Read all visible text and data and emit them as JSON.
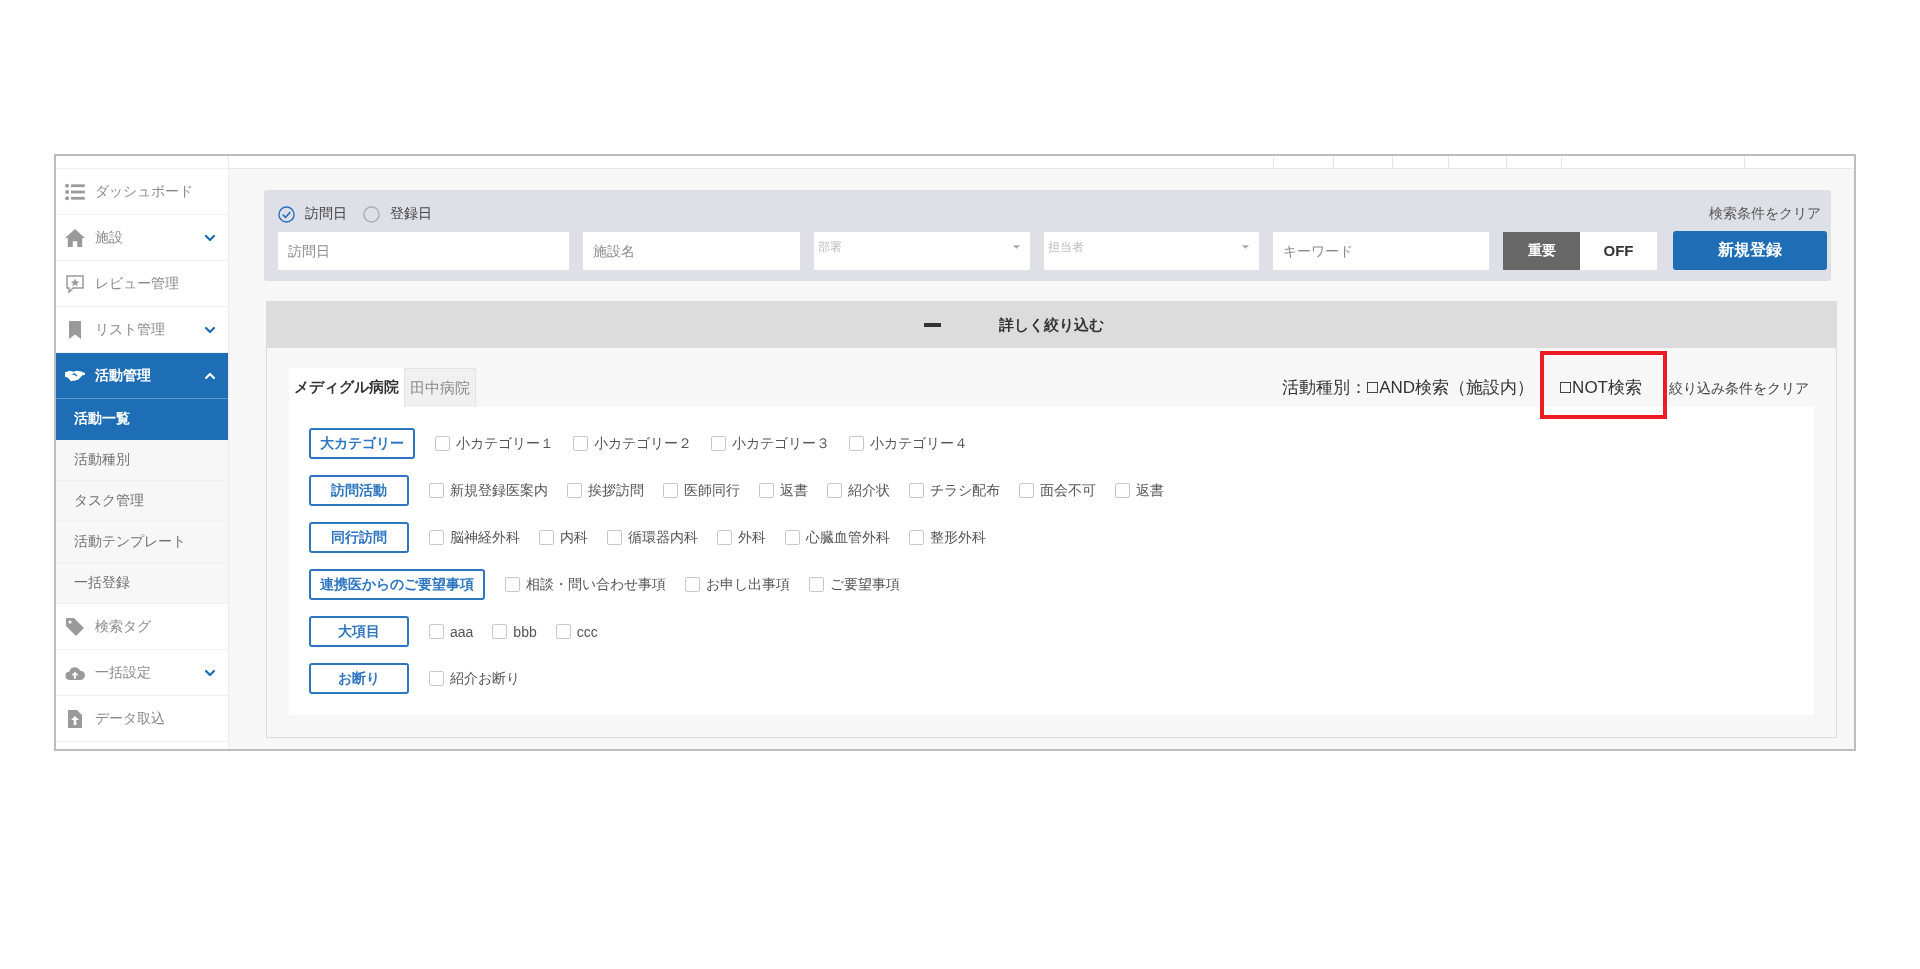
{
  "sidebar": {
    "items": [
      {
        "label": "ダッシュボード",
        "selected": false
      },
      {
        "label": "施設",
        "selected": false,
        "expanded": false
      },
      {
        "label": "レビュー管理",
        "selected": false
      },
      {
        "label": "リスト管理",
        "selected": false,
        "expanded": false
      },
      {
        "label": "活動管理",
        "selected": true,
        "expanded": true,
        "children": [
          {
            "label": "活動一覧",
            "selected": true
          },
          {
            "label": "活動種別",
            "selected": false
          },
          {
            "label": "タスク管理",
            "selected": false
          },
          {
            "label": "活動テンプレート",
            "selected": false
          },
          {
            "label": "一括登録",
            "selected": false
          }
        ]
      },
      {
        "label": "検索タグ",
        "selected": false
      },
      {
        "label": "一括設定",
        "selected": false,
        "expanded": false
      },
      {
        "label": "データ取込",
        "selected": false
      }
    ]
  },
  "search": {
    "date_type": [
      {
        "label": "訪問日",
        "selected": true
      },
      {
        "label": "登録日",
        "selected": false
      }
    ],
    "clear": "検索条件をクリア",
    "fields": [
      {
        "kind": "text",
        "placeholder": "訪問日"
      },
      {
        "kind": "text",
        "placeholder": "施設名"
      },
      {
        "kind": "select",
        "placeholder": "部署"
      },
      {
        "kind": "select",
        "placeholder": "担当者"
      },
      {
        "kind": "text",
        "placeholder": "キーワード"
      }
    ],
    "important_toggle": {
      "label": "重要",
      "value": "OFF",
      "on": false
    },
    "new_button": "新規登録"
  },
  "filter": {
    "expanded": true,
    "title": "詳しく絞り込む",
    "tabs": [
      {
        "label": "メディグル病院",
        "selected": true
      },
      {
        "label": "田中病院",
        "selected": false
      }
    ],
    "activity_type_label": "活動種別：",
    "and_search": {
      "label": "AND検索（施設内）",
      "checked": false
    },
    "not_search": {
      "label": "NOT検索",
      "checked": false,
      "highlighted": true
    },
    "clear": "絞り込み条件をクリア",
    "categories": [
      {
        "label": "大カテゴリー",
        "options": [
          {
            "label": "小カテゴリー１",
            "checked": false
          },
          {
            "label": "小カテゴリー２",
            "checked": false
          },
          {
            "label": "小カテゴリー３",
            "checked": false
          },
          {
            "label": "小カテゴリー４",
            "checked": false
          }
        ]
      },
      {
        "label": "訪問活動",
        "options": [
          {
            "label": "新規登録医案内",
            "checked": false
          },
          {
            "label": "挨拶訪問",
            "checked": false
          },
          {
            "label": "医師同行",
            "checked": false
          },
          {
            "label": "返書",
            "checked": false
          },
          {
            "label": "紹介状",
            "checked": false
          },
          {
            "label": "チラシ配布",
            "checked": false
          },
          {
            "label": "面会不可",
            "checked": false
          },
          {
            "label": "返書",
            "checked": false
          }
        ]
      },
      {
        "label": "同行訪問",
        "options": [
          {
            "label": "脳神経外科",
            "checked": false
          },
          {
            "label": "内科",
            "checked": false
          },
          {
            "label": "循環器内科",
            "checked": false
          },
          {
            "label": "外科",
            "checked": false
          },
          {
            "label": "心臓血管外科",
            "checked": false
          },
          {
            "label": "整形外科",
            "checked": false
          }
        ]
      },
      {
        "label": "連携医からのご要望事項",
        "options": [
          {
            "label": "相談・問い合わせ事項",
            "checked": false
          },
          {
            "label": "お申し出事項",
            "checked": false
          },
          {
            "label": "ご要望事項",
            "checked": false
          }
        ]
      },
      {
        "label": "大項目",
        "options": [
          {
            "label": "aaa",
            "checked": false
          },
          {
            "label": "bbb",
            "checked": false
          },
          {
            "label": "ccc",
            "checked": false
          }
        ]
      },
      {
        "label": "お断り",
        "options": [
          {
            "label": "紹介お断り",
            "checked": false
          }
        ]
      }
    ]
  }
}
